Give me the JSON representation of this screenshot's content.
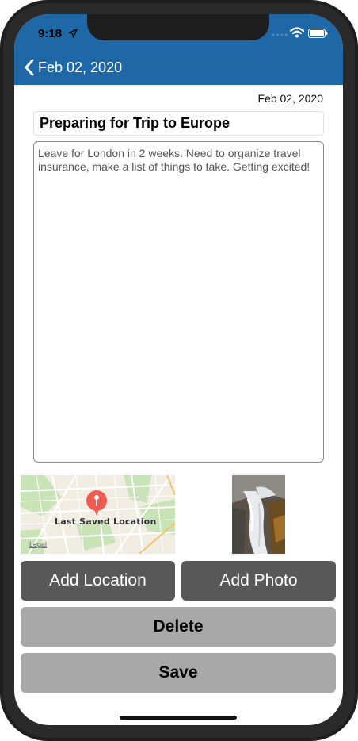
{
  "status_bar": {
    "time": "9:18",
    "icons": [
      "location-arrow-icon",
      "signal-dots-icon",
      "wifi-icon",
      "battery-icon"
    ]
  },
  "nav": {
    "back_label": "Feb 02, 2020",
    "color": "#1f68a8"
  },
  "entry": {
    "date": "Feb 02, 2020",
    "title": "Preparing for Trip to Europe",
    "body": "Leave for London in 2 weeks.  Need to organize travel insurance, make a list of things to take.  Getting excited!"
  },
  "map": {
    "label": "Last Saved Location",
    "legal": "Legal",
    "pin_icon": "map-pin-icon"
  },
  "buttons": {
    "add_location": "Add Location",
    "add_photo": "Add Photo",
    "delete": "Delete",
    "save": "Save"
  }
}
